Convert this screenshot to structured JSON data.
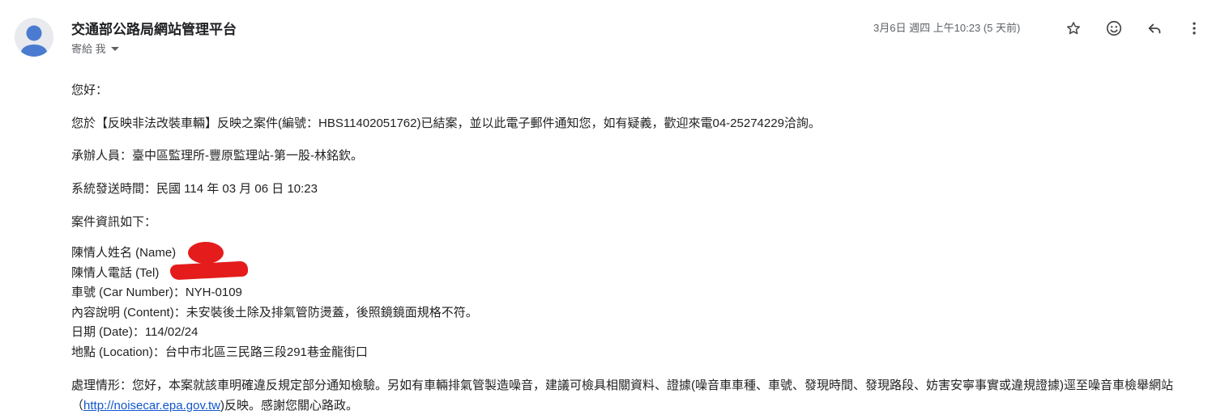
{
  "header": {
    "sender_name": "交通部公路局網站管理平台",
    "to_label": "寄給 我",
    "date": "3月6日 週四 上午10:23 (5 天前)"
  },
  "icons": {
    "avatar": "person-avatar-icon",
    "star": "star-icon",
    "emoji": "emoji-reaction-icon",
    "reply": "reply-icon",
    "more": "more-vert-icon",
    "colors": {
      "avatar_bg": "#e8eaed",
      "avatar_fg": "#4a7bd0",
      "redaction": "#e41c1c",
      "link": "#1155cc"
    }
  },
  "message": {
    "greeting": "您好：",
    "line1": "您於【反映非法改裝車輛】反映之案件(編號：HBS11402051762)已結案，並以此電子郵件通知您，如有疑義，歡迎來電04-25274229洽詢。",
    "line2": "承辦人員：臺中區監理所-豐原監理站-第一股-林銘欽。",
    "line3": "系統發送時間：民國 114 年 03 月 06 日 10:23",
    "line4": "案件資訊如下：",
    "info": {
      "name_label": "陳情人姓名 (Name)",
      "tel_label": "陳情人電話 (Tel)",
      "car": "車號 (Car Number)：NYH-0109",
      "content": "內容說明 (Content)：未安裝後土除及排氣管防燙蓋，後照鏡鏡面規格不符。",
      "date": "日期 (Date)：114/02/24",
      "location": "地點 (Location)：台中市北區三民路三段291巷金龍街口"
    },
    "handling_pre": "處理情形：您好，本案就該車明確違反規定部分通知檢驗。另如有車輛排氣管製造噪音，建議可檢具相關資料、證據(噪音車車種、車號、發現時間、發現路段、妨害安寧事實或違規證據)逕至噪音車檢舉網站（",
    "handling_link": "http://noisecar.epa.gov.tw",
    "handling_post": ")反映。感謝您關心路政。"
  }
}
